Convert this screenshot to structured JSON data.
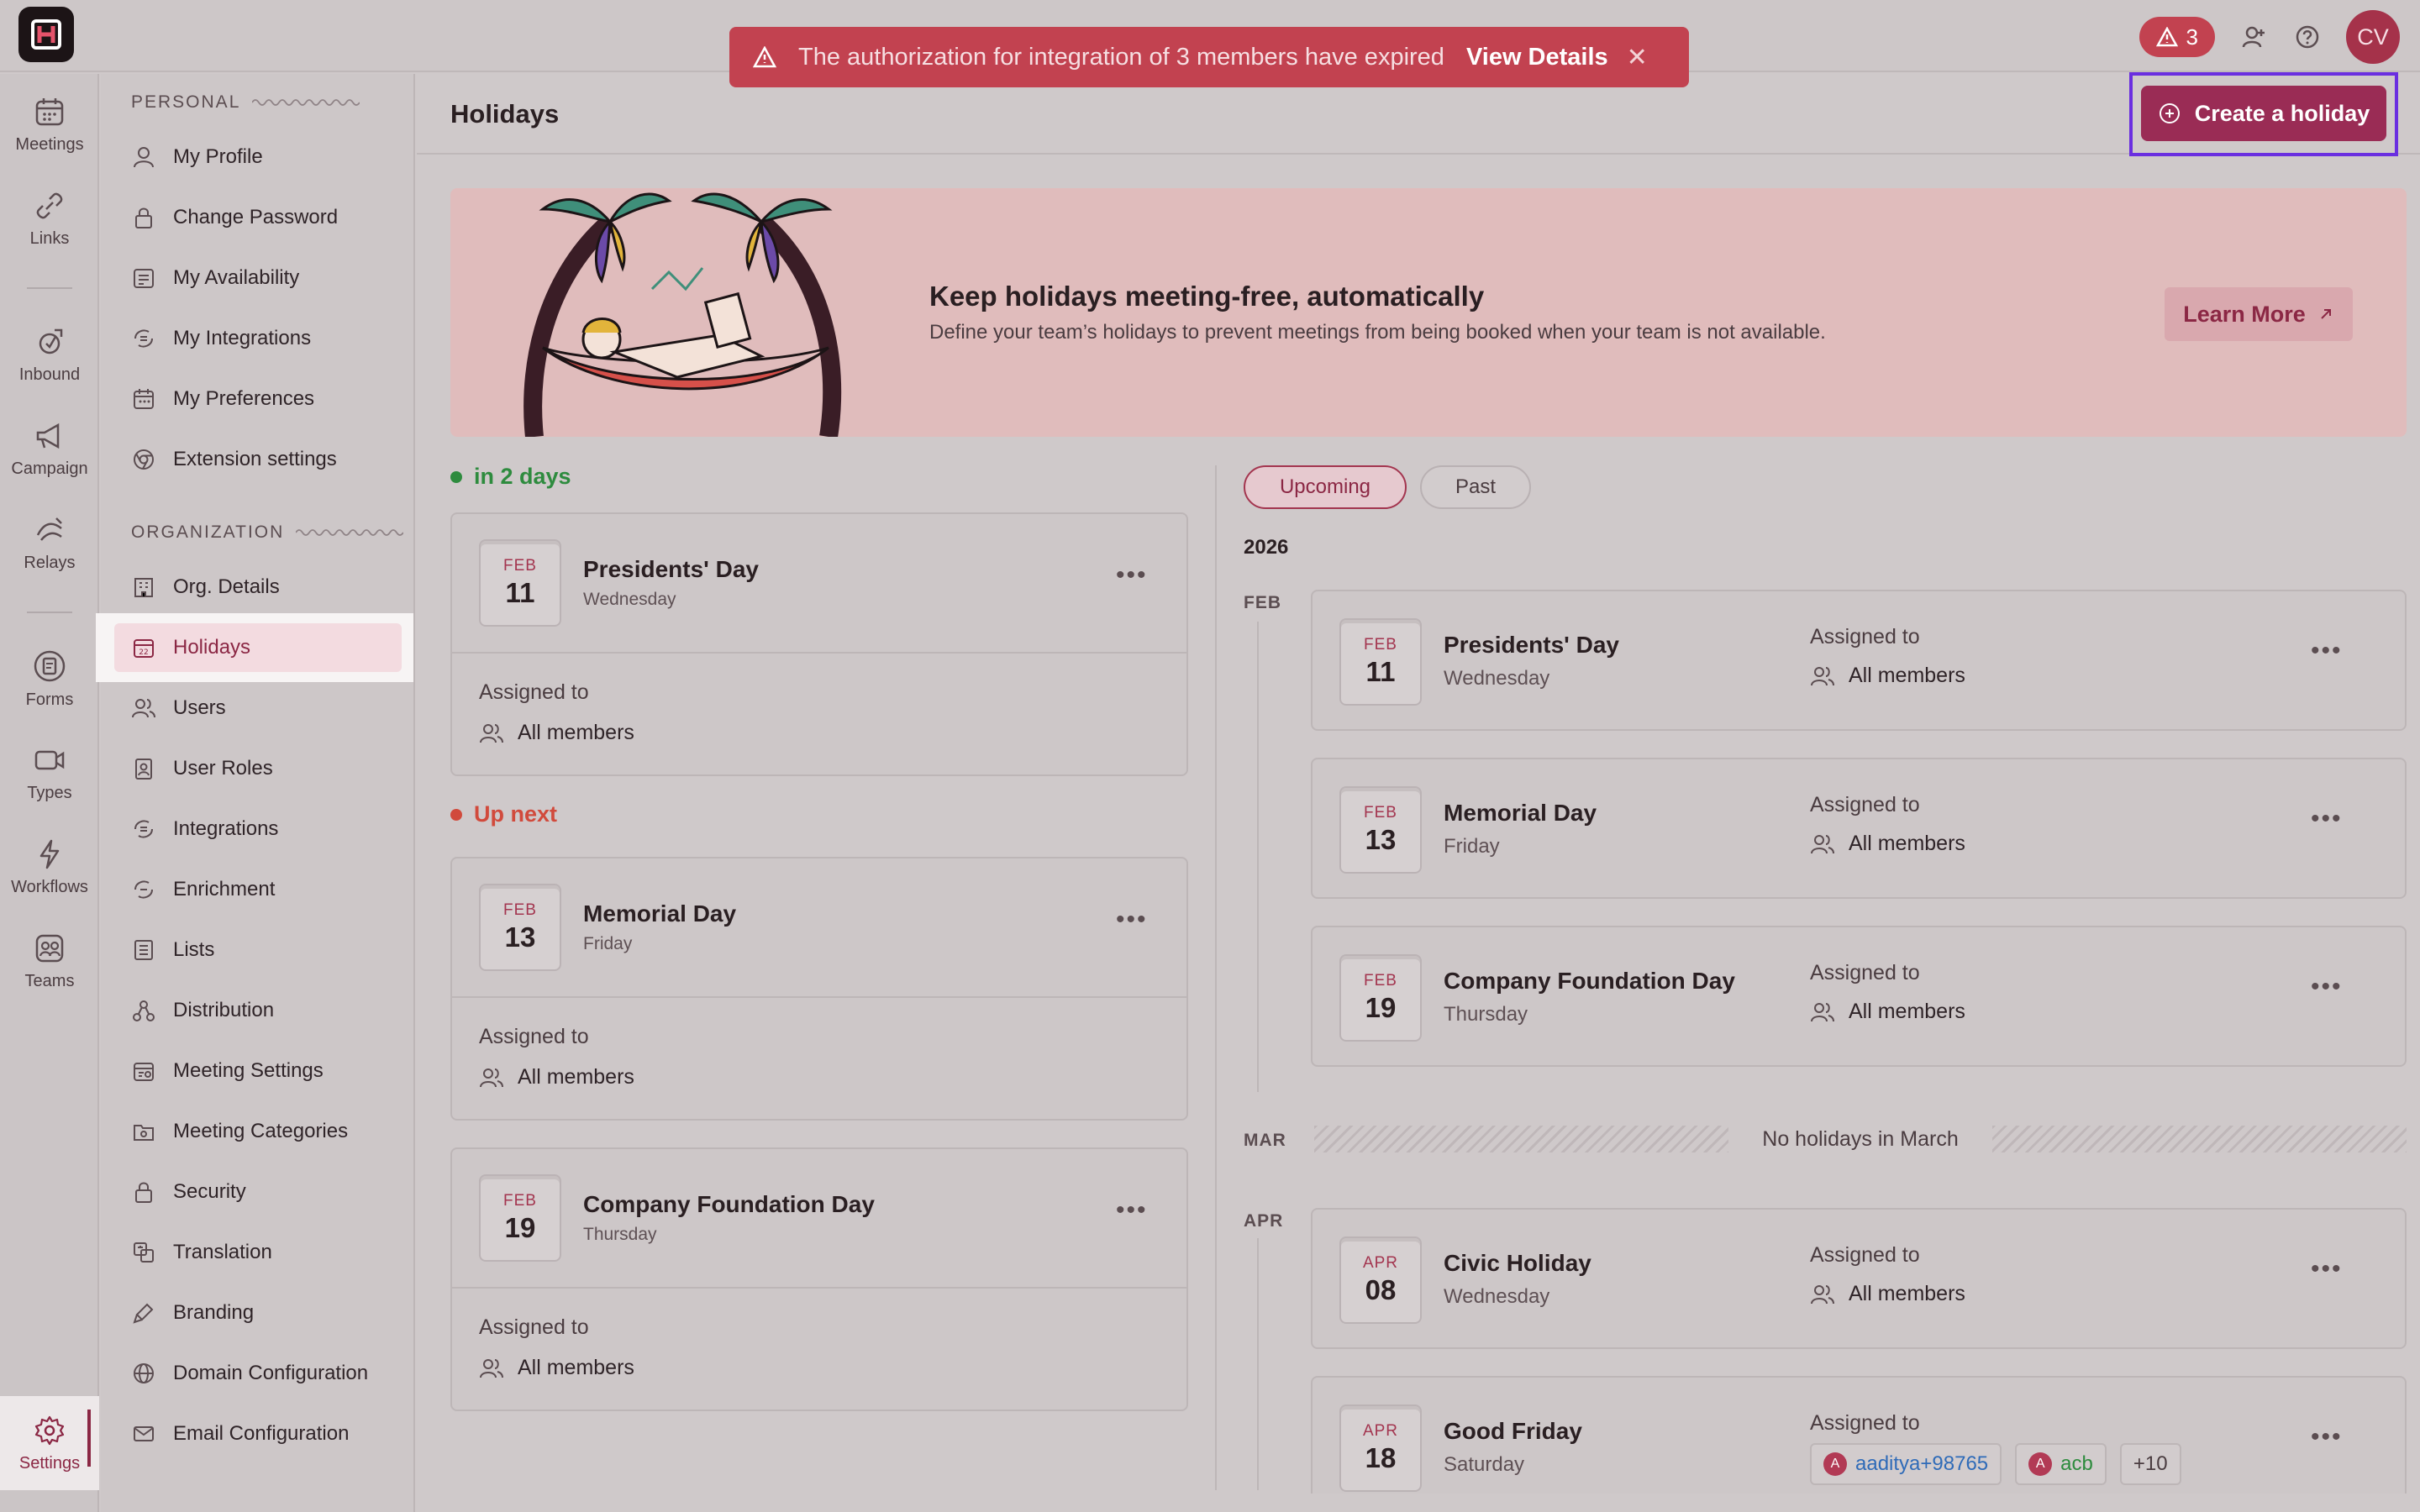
{
  "alert": {
    "message": "The authorization for integration of 3 members have expired",
    "link": "View Details"
  },
  "topbar": {
    "error_count": "3",
    "avatar_initials": "CV"
  },
  "rail": {
    "items": [
      {
        "label": "Meetings",
        "icon": "calendar-icon"
      },
      {
        "label": "Links",
        "icon": "link-icon"
      },
      {
        "label": "Inbound",
        "icon": "inbound-icon"
      },
      {
        "label": "Campaign",
        "icon": "megaphone-icon"
      },
      {
        "label": "Relays",
        "icon": "relay-icon"
      },
      {
        "label": "Forms",
        "icon": "forms-icon"
      },
      {
        "label": "Types",
        "icon": "types-icon"
      },
      {
        "label": "Workflows",
        "icon": "bolt-icon"
      },
      {
        "label": "Teams",
        "icon": "teams-icon"
      },
      {
        "label": "Settings",
        "icon": "gear-icon"
      }
    ]
  },
  "sidebar": {
    "personal_label": "PERSONAL",
    "organization_label": "ORGANIZATION",
    "personal": [
      "My Profile",
      "Change Password",
      "My Availability",
      "My Integrations",
      "My Preferences",
      "Extension settings"
    ],
    "organization": [
      "Org. Details",
      "Holidays",
      "Users",
      "User Roles",
      "Integrations",
      "Enrichment",
      "Lists",
      "Distribution",
      "Meeting Settings",
      "Meeting Categories",
      "Security",
      "Translation",
      "Branding",
      "Domain Configuration",
      "Email Configuration"
    ]
  },
  "header": {
    "title": "Holidays",
    "create_label": "Create a holiday"
  },
  "hero": {
    "title": "Keep holidays meeting-free, automatically",
    "subtitle": "Define your team’s holidays to prevent meetings from being booked when your team is not available.",
    "learn_more": "Learn More"
  },
  "left": {
    "in_days_label": "in 2 days",
    "up_next_label": "Up next",
    "assigned_label": "Assigned to",
    "cards": [
      {
        "month": "FEB",
        "day": "11",
        "name": "Presidents' Day",
        "weekday": "Wednesday",
        "members": "All members"
      },
      {
        "month": "FEB",
        "day": "13",
        "name": "Memorial Day",
        "weekday": "Friday",
        "members": "All members"
      },
      {
        "month": "FEB",
        "day": "19",
        "name": "Company Foundation Day",
        "weekday": "Thursday",
        "members": "All members"
      }
    ]
  },
  "right": {
    "tabs": [
      "Upcoming",
      "Past"
    ],
    "year": "2026",
    "months": [
      "FEB",
      "MAR",
      "APR"
    ],
    "no_holidays": "No holidays in March",
    "assigned_label": "Assigned to",
    "items": [
      {
        "month": "FEB",
        "day": "11",
        "name": "Presidents' Day",
        "weekday": "Wednesday",
        "members": "All members"
      },
      {
        "month": "FEB",
        "day": "13",
        "name": "Memorial Day",
        "weekday": "Friday",
        "members": "All members"
      },
      {
        "month": "FEB",
        "day": "19",
        "name": "Company Foundation Day",
        "weekday": "Thursday",
        "members": "All members"
      },
      {
        "month": "APR",
        "day": "08",
        "name": "Civic Holiday",
        "weekday": "Wednesday",
        "members": "All members"
      },
      {
        "month": "APR",
        "day": "18",
        "name": "Good Friday",
        "weekday": "Saturday",
        "chip1": "aaditya+98765",
        "chip2": "acb",
        "more": "+10",
        "chip_avatar": "A"
      }
    ]
  },
  "colors": {
    "brand": "#9a2c55",
    "alert": "#c24250",
    "focus_outline": "#6a2ee0",
    "green": "#2e8b3e",
    "red": "#d14a3c"
  }
}
